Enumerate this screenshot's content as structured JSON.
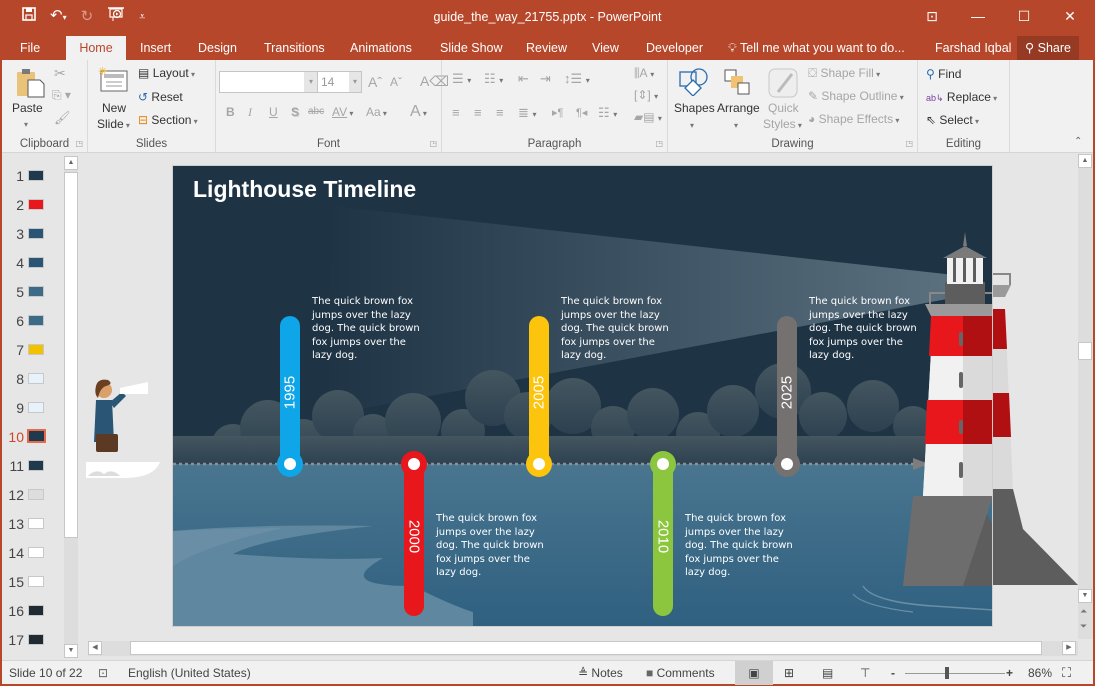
{
  "window": {
    "title": "guide_the_way_21755.pptx - PowerPoint",
    "controls": {
      "restore_ribbon": "⊡",
      "minimize": "—",
      "maximize": "☐",
      "close": "✕"
    }
  },
  "qat": {
    "save": "save-icon",
    "undo": "undo-icon",
    "redo": "redo-icon",
    "present": "start-from-beginning-icon",
    "customize": "customize-qat-icon"
  },
  "tabs": [
    {
      "label": "File"
    },
    {
      "label": "Home",
      "active": true
    },
    {
      "label": "Insert"
    },
    {
      "label": "Design"
    },
    {
      "label": "Transitions"
    },
    {
      "label": "Animations"
    },
    {
      "label": "Slide Show"
    },
    {
      "label": "Review"
    },
    {
      "label": "View"
    },
    {
      "label": "Developer"
    }
  ],
  "tellme": "Tell me what you want to do...",
  "user": "Farshad Iqbal",
  "share": "Share",
  "ribbon": {
    "clipboard": {
      "label": "Clipboard",
      "paste": "Paste"
    },
    "slides": {
      "label": "Slides",
      "new_slide_1": "New",
      "new_slide_2": "Slide",
      "layout": "Layout",
      "reset": "Reset",
      "section": "Section"
    },
    "font": {
      "label": "Font",
      "font_name": "",
      "font_size": "14",
      "bold": "B",
      "italic": "I",
      "underline": "U",
      "shadow": "S",
      "strike": "abc",
      "spacing": "AV",
      "case": "Aa",
      "color": "A"
    },
    "paragraph": {
      "label": "Paragraph"
    },
    "drawing": {
      "label": "Drawing",
      "shapes": "Shapes",
      "arrange": "Arrange",
      "quick_styles_1": "Quick",
      "quick_styles_2": "Styles",
      "shape_fill": "Shape Fill",
      "shape_outline": "Shape Outline",
      "shape_effects": "Shape Effects"
    },
    "editing": {
      "label": "Editing",
      "find": "Find",
      "replace": "Replace",
      "select": "Select"
    }
  },
  "thumbnails": [
    {
      "num": "1"
    },
    {
      "num": "2"
    },
    {
      "num": "3"
    },
    {
      "num": "4"
    },
    {
      "num": "5"
    },
    {
      "num": "6"
    },
    {
      "num": "7"
    },
    {
      "num": "8"
    },
    {
      "num": "9"
    },
    {
      "num": "10",
      "selected": true
    },
    {
      "num": "11"
    },
    {
      "num": "12"
    },
    {
      "num": "13"
    },
    {
      "num": "14"
    },
    {
      "num": "15"
    },
    {
      "num": "16"
    },
    {
      "num": "17"
    }
  ],
  "slide": {
    "title": "Lighthouse Timeline",
    "milestones": [
      {
        "year": "1995",
        "color": "#0ea5e9",
        "text": "The quick brown fox jumps over the lazy dog. The quick brown fox jumps over the lazy dog.",
        "position": "above"
      },
      {
        "year": "2000",
        "color": "#e8171c",
        "text": "The quick brown fox jumps over the lazy dog. The quick brown fox jumps over the lazy dog.",
        "position": "below"
      },
      {
        "year": "2005",
        "color": "#fdc40d",
        "text": "The quick brown fox jumps over the lazy dog. The quick brown fox jumps over the lazy dog.",
        "position": "above"
      },
      {
        "year": "2010",
        "color": "#8cc63f",
        "text": "The quick brown fox jumps over the lazy dog. The quick brown fox jumps over the lazy dog.",
        "position": "below"
      },
      {
        "year": "2025",
        "color": "#757171",
        "text": "The quick brown fox jumps over the lazy dog. The quick brown fox jumps over the lazy dog.",
        "position": "above"
      }
    ]
  },
  "status": {
    "slide_count": "Slide 10 of 22",
    "language": "English (United States)",
    "notes": "Notes",
    "comments": "Comments",
    "zoom_minus": "-",
    "zoom_plus": "+",
    "zoom": "86%"
  },
  "colors": {
    "accent": "#b7472a",
    "sky": "#1e3344",
    "water": "#3d6a86"
  }
}
